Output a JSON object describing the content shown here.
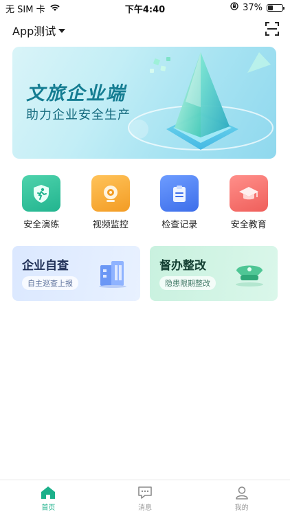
{
  "status_bar": {
    "carrier": "无 SIM 卡",
    "time": "下午4:40",
    "battery_percent": "37%",
    "battery_level": 0.37
  },
  "header": {
    "app_selector": "App测试"
  },
  "banner": {
    "title": "文旅企业端",
    "subtitle": "助力企业安全生产"
  },
  "quick_actions": [
    {
      "label": "安全演练",
      "icon": "running-shield-icon",
      "color": "#27c199"
    },
    {
      "label": "视频监控",
      "icon": "camera-icon",
      "color": "#f7a531"
    },
    {
      "label": "检查记录",
      "icon": "clipboard-icon",
      "color": "#4c82f3"
    },
    {
      "label": "安全教育",
      "icon": "graduation-cap-icon",
      "color": "#f36c6a"
    }
  ],
  "cards": [
    {
      "title": "企业自查",
      "tag": "自主巡查上报",
      "icon": "building-icon"
    },
    {
      "title": "督办整改",
      "tag": "隐患限期整改",
      "icon": "inspector-hat-icon"
    }
  ],
  "tabbar": [
    {
      "label": "首页",
      "icon": "home-icon",
      "active": true
    },
    {
      "label": "消息",
      "icon": "message-icon",
      "active": false
    },
    {
      "label": "我的",
      "icon": "user-icon",
      "active": false
    }
  ],
  "colors": {
    "accent": "#1bb08a",
    "banner_title": "#157d92"
  }
}
